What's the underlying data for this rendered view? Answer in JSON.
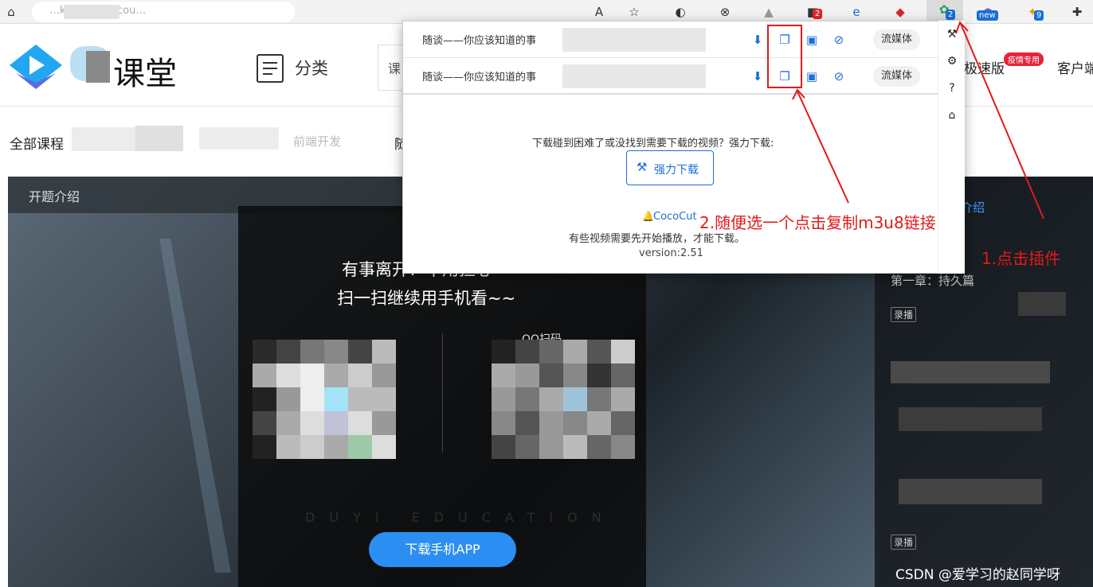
{
  "browser": {
    "url": "…ke.qq.com/cou…",
    "extension_badges": {
      "first": "2",
      "new": "new",
      "nine": "9",
      "active": "2"
    }
  },
  "header": {
    "brand": "课堂",
    "category": "分类",
    "search_prefix": "课",
    "speed_version": "极速版",
    "epidemic_badge": "疫情专用",
    "client": "客户端"
  },
  "nav": {
    "all_courses": "全部课程",
    "item_mid": "前端开发",
    "item_right": "随"
  },
  "hero": {
    "intro_tab": "开题介绍",
    "modal_line1": "有事离开？不用担心",
    "modal_line2": "扫一扫继续用手机看~~",
    "qq_scan": "QQ扫码",
    "watermark": "DUYI EDUCATION",
    "download_app": "下载手机APP",
    "side_intro": "介绍",
    "chapter": "第一章：持久篇",
    "tag1": "录播",
    "tag2": "录播",
    "csdn": "CSDN @爱学习的赵同学呀"
  },
  "popup": {
    "videos": [
      {
        "title": "随谈——你应该知道的事",
        "stream": "流媒体"
      },
      {
        "title": "随谈——你应该知道的事",
        "stream": "流媒体"
      }
    ],
    "hint": "下载碰到困难了或没找到需要下载的视频？强力下载:",
    "force_download": "强力下载",
    "brand": "CocoCut",
    "note": "有些视频需要先开始播放，才能下载。",
    "version": "version:2.51"
  },
  "annotations": {
    "step1": "1.点击插件",
    "step2": "2.随便选一个点击复制m3u8链接"
  },
  "colors": {
    "accent": "#1a6fd8",
    "annotation": "#e21a1a",
    "brand_blue": "#23a6f0"
  }
}
